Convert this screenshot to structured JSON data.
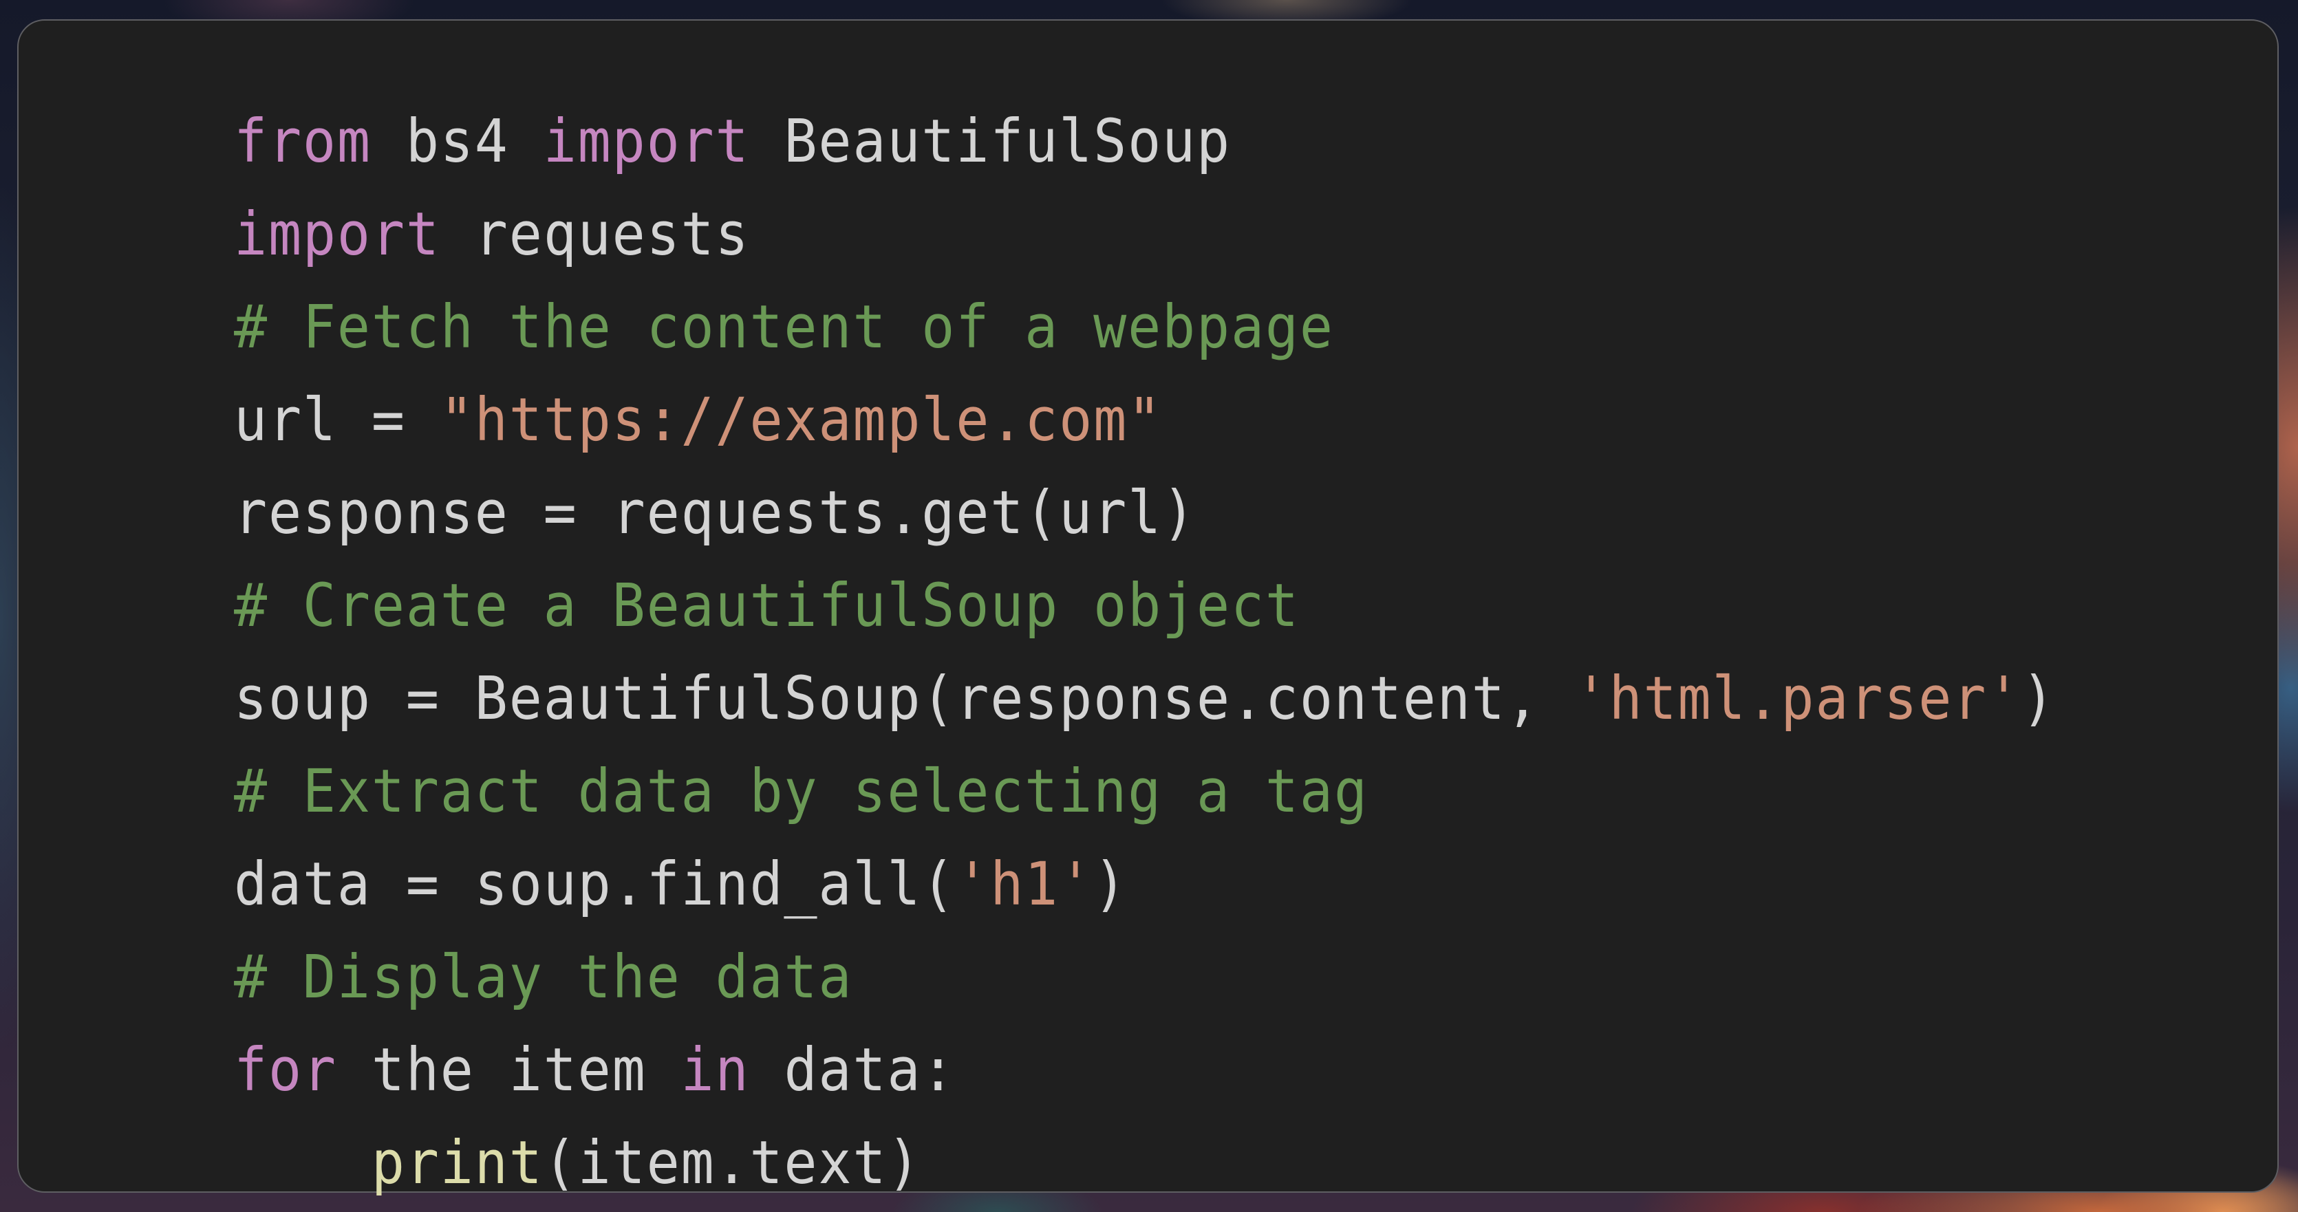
{
  "editor": {
    "language": "python",
    "theme_colors": {
      "background": "#1f1f1f",
      "keyword": "#c586c0",
      "text": "#d4d4d4",
      "comment": "#6a9955",
      "string": "#ce9178",
      "function": "#dcdcaa"
    },
    "lines": [
      {
        "tokens": [
          {
            "t": "kw",
            "v": "from"
          },
          {
            "t": "tx",
            "v": " bs4 "
          },
          {
            "t": "kw",
            "v": "import"
          },
          {
            "t": "tx",
            "v": " BeautifulSoup"
          }
        ]
      },
      {
        "tokens": [
          {
            "t": "kw",
            "v": "import"
          },
          {
            "t": "tx",
            "v": " requests"
          }
        ]
      },
      {
        "tokens": [
          {
            "t": "cm",
            "v": "# Fetch the content of a webpage"
          }
        ]
      },
      {
        "tokens": [
          {
            "t": "tx",
            "v": "url = "
          },
          {
            "t": "st",
            "v": "\"https://example.com\""
          }
        ]
      },
      {
        "tokens": [
          {
            "t": "tx",
            "v": "response = requests.get(url)"
          }
        ]
      },
      {
        "tokens": [
          {
            "t": "cm",
            "v": "# Create a BeautifulSoup object"
          }
        ]
      },
      {
        "tokens": [
          {
            "t": "tx",
            "v": "soup = BeautifulSoup(response.content, "
          },
          {
            "t": "st",
            "v": "'html.parser'"
          },
          {
            "t": "tx",
            "v": ")"
          }
        ]
      },
      {
        "tokens": [
          {
            "t": "cm",
            "v": "# Extract data by selecting a tag"
          }
        ]
      },
      {
        "tokens": [
          {
            "t": "tx",
            "v": "data = soup.find_all("
          },
          {
            "t": "st",
            "v": "'h1'"
          },
          {
            "t": "tx",
            "v": ")"
          }
        ]
      },
      {
        "tokens": [
          {
            "t": "cm",
            "v": "# Display the data"
          }
        ]
      },
      {
        "tokens": [
          {
            "t": "kw",
            "v": "for"
          },
          {
            "t": "tx",
            "v": " the item "
          },
          {
            "t": "kw",
            "v": "in"
          },
          {
            "t": "tx",
            "v": " data:"
          }
        ]
      },
      {
        "tokens": [
          {
            "t": "tx",
            "v": "    "
          },
          {
            "t": "fn",
            "v": "print"
          },
          {
            "t": "tx",
            "v": "(item.text)"
          }
        ]
      }
    ]
  }
}
